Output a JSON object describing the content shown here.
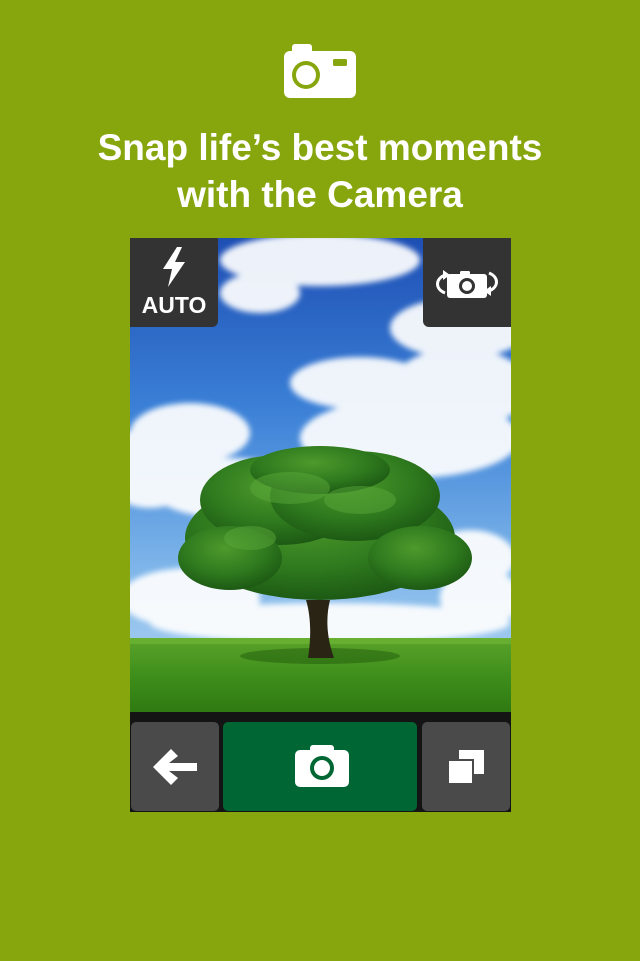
{
  "colors": {
    "background": "#87a60e",
    "headline": "#ffffff",
    "shutter": "#006633",
    "overlay_button": "#333333",
    "control_button": "#4a4a4a"
  },
  "header": {
    "icon": "camera-icon",
    "headline_line1": "Snap life’s best moments",
    "headline_line2": "with the Camera"
  },
  "viewfinder": {
    "subject": "tree-photo",
    "flash": {
      "icon": "lightning-icon",
      "mode": "AUTO"
    },
    "switch_camera": {
      "icon": "camera-switch-icon"
    }
  },
  "controls": {
    "back": {
      "icon": "arrow-left-icon"
    },
    "shutter": {
      "icon": "camera-icon"
    },
    "gallery": {
      "icon": "stacked-squares-icon"
    }
  }
}
